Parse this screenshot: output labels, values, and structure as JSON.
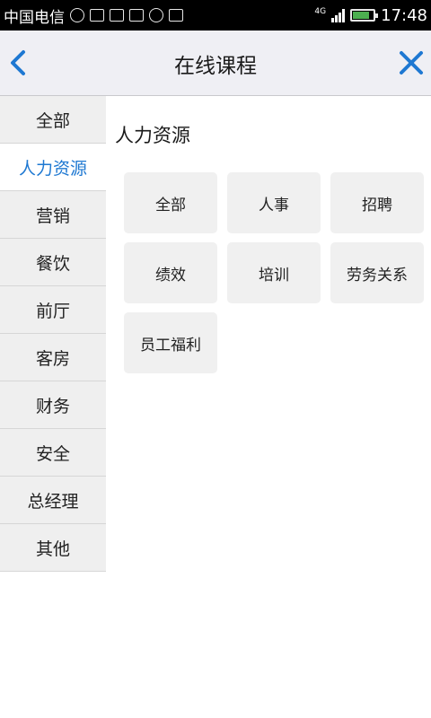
{
  "status_bar": {
    "carrier": "中国电信",
    "network": "4G",
    "time": "17:48",
    "battery_percent": 80,
    "colors": {
      "battery": "#4caf50"
    }
  },
  "header": {
    "title": "在线课程",
    "back_icon": "chevron-left-icon",
    "close_icon": "close-icon",
    "accent_color": "#1e78d2"
  },
  "sidebar": {
    "items": [
      {
        "label": "全部",
        "active": false
      },
      {
        "label": "人力资源",
        "active": true
      },
      {
        "label": "营销",
        "active": false
      },
      {
        "label": "餐饮",
        "active": false
      },
      {
        "label": "前厅",
        "active": false
      },
      {
        "label": "客房",
        "active": false
      },
      {
        "label": "财务",
        "active": false
      },
      {
        "label": "安全",
        "active": false
      },
      {
        "label": "总经理",
        "active": false
      },
      {
        "label": "其他",
        "active": false
      }
    ]
  },
  "content": {
    "section_title": "人力资源",
    "tags": [
      {
        "label": "全部"
      },
      {
        "label": "人事"
      },
      {
        "label": "招聘"
      },
      {
        "label": "绩效"
      },
      {
        "label": "培训"
      },
      {
        "label": "劳务关系"
      },
      {
        "label": "员工福利"
      }
    ]
  }
}
